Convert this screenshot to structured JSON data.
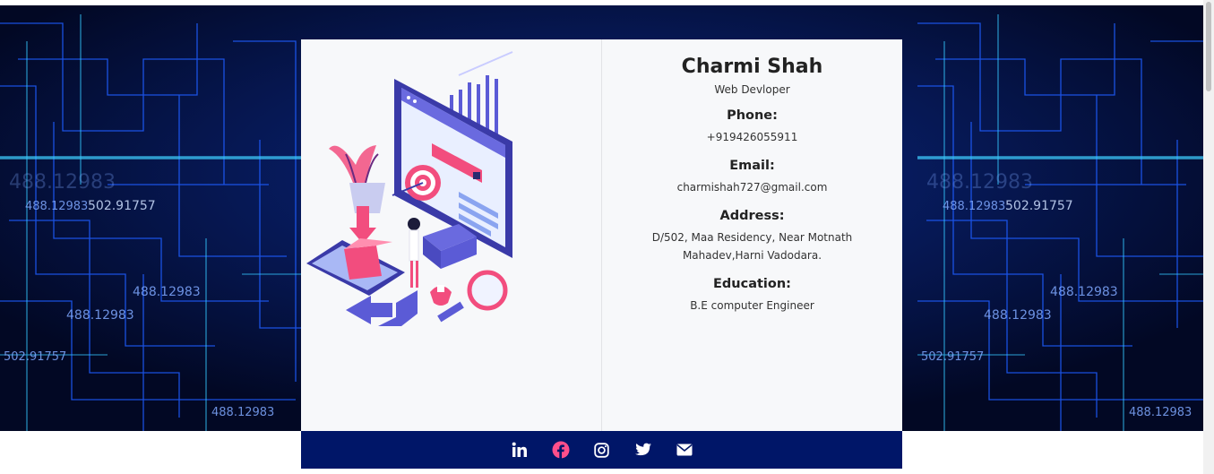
{
  "profile": {
    "name": "Charmi Shah",
    "role": "Web Devloper",
    "phone_label": "Phone:",
    "phone": "+919426055911",
    "email_label": "Email:",
    "email": "charmishah727@gmail.com",
    "address_label": "Address:",
    "address": "D/502, Maa Residency, Near Motnath Mahadev,Harni Vadodara.",
    "education_label": "Education:",
    "education": "B.E computer Engineer"
  },
  "background_numbers": [
    "488.12983",
    "502.91757",
    "488.12983",
    "488.12983",
    "502.91757",
    "488.12983",
    "488.12983",
    "502.91757",
    "488.12983",
    "488.12983",
    "502.91757",
    "488.12983",
    "488.12983",
    "488.12983"
  ],
  "footer": {
    "icons": [
      "linkedin-icon",
      "facebook-icon",
      "instagram-icon",
      "twitter-icon",
      "envelope-icon"
    ]
  },
  "colors": {
    "footer_bg": "#001668",
    "card_bg": "#f7f8fa",
    "background": "#030a2e",
    "facebook": "#ff4f8b",
    "accent_purple": "#5b5bd6",
    "accent_pink": "#f24d7e"
  }
}
